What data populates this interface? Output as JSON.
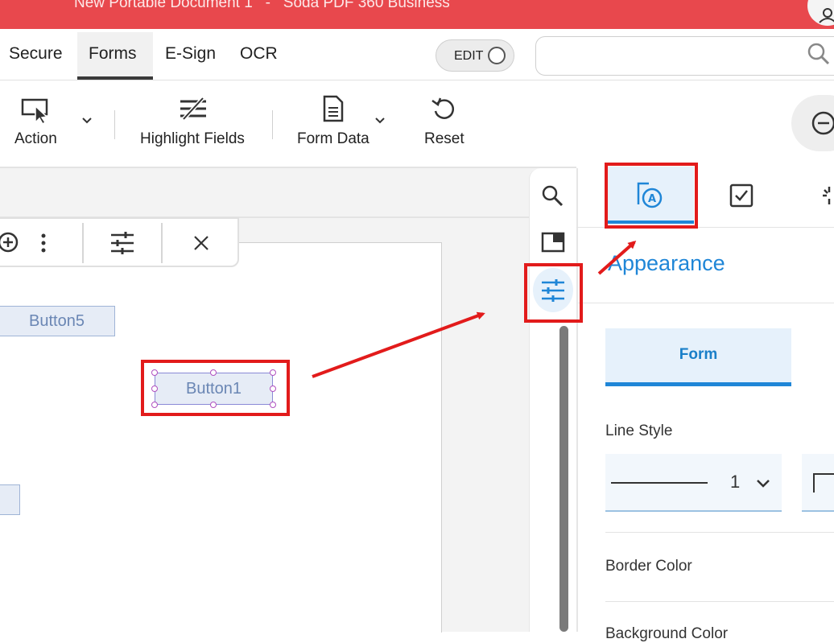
{
  "window": {
    "title": "New Portable Document 1   -   Soda PDF 360 Business"
  },
  "menu_tabs": [
    {
      "label": "Secure"
    },
    {
      "label": "Forms",
      "active": true
    },
    {
      "label": "E-Sign"
    },
    {
      "label": "OCR"
    }
  ],
  "edit_toggle": {
    "label": "EDIT"
  },
  "search": {
    "placeholder": "",
    "icon": "search-icon"
  },
  "toolbar": {
    "action": {
      "label": "Action",
      "icon": "cursor-select-icon"
    },
    "highlight_fields": {
      "label": "Highlight Fields",
      "icon": "highlight-fields-icon"
    },
    "form_data": {
      "label": "Form Data",
      "icon": "document-icon"
    },
    "reset": {
      "label": "Reset",
      "icon": "reset-icon"
    }
  },
  "document": {
    "fields": [
      {
        "label": "Button5"
      },
      {
        "label": "Button1",
        "selected": true
      }
    ]
  },
  "panel": {
    "section_title": "Appearance",
    "subtab": "Form",
    "line_style": {
      "label": "Line Style",
      "value": "1"
    },
    "border_color": {
      "label": "Border Color"
    },
    "background_color": {
      "label": "Background Color"
    }
  },
  "colors": {
    "titlebar": "#e8484d",
    "accent": "#1f86d7",
    "annotation": "#e21b1b"
  }
}
